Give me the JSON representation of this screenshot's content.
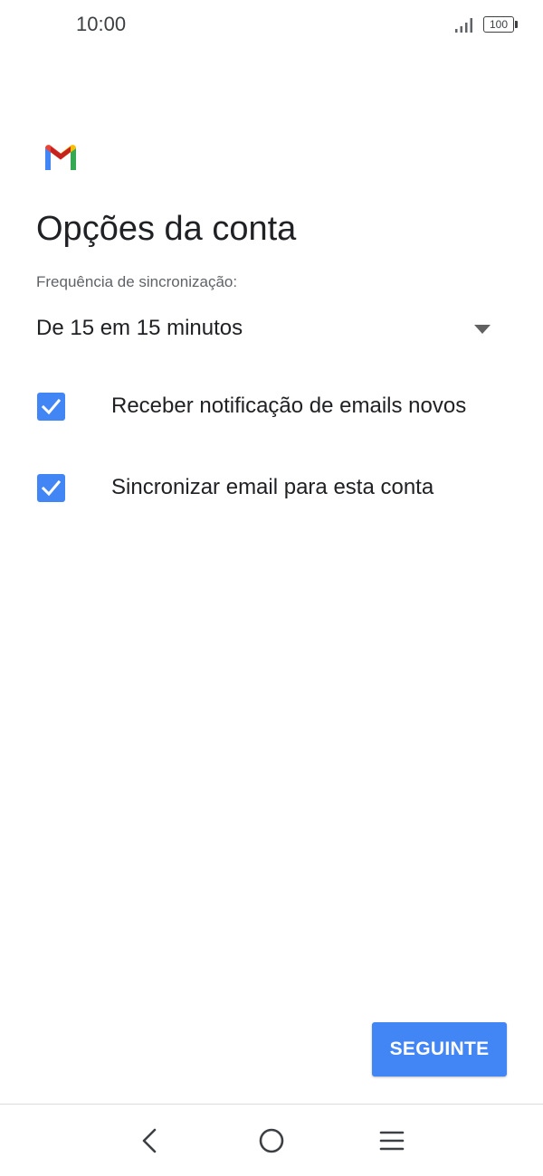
{
  "status_bar": {
    "time": "10:00",
    "battery": "100",
    "icons": [
      "signal-icon",
      "battery-icon"
    ]
  },
  "logo": {
    "icon": "gmail-logo"
  },
  "title": "Opções da conta",
  "sync": {
    "label": "Frequência de sincronização:",
    "selected": "De 15 em 15 minutos"
  },
  "options": [
    {
      "label": "Receber notificação de emails novos",
      "checked": true
    },
    {
      "label": "Sincronizar email para esta conta",
      "checked": true
    }
  ],
  "next_button": {
    "label": "SEGUINTE"
  },
  "nav_bar": {
    "icons": [
      "back-icon",
      "home-icon",
      "recents-icon"
    ]
  },
  "colors": {
    "accent": "#4285f4",
    "text": "#202124",
    "secondary_text": "#5f6368"
  }
}
